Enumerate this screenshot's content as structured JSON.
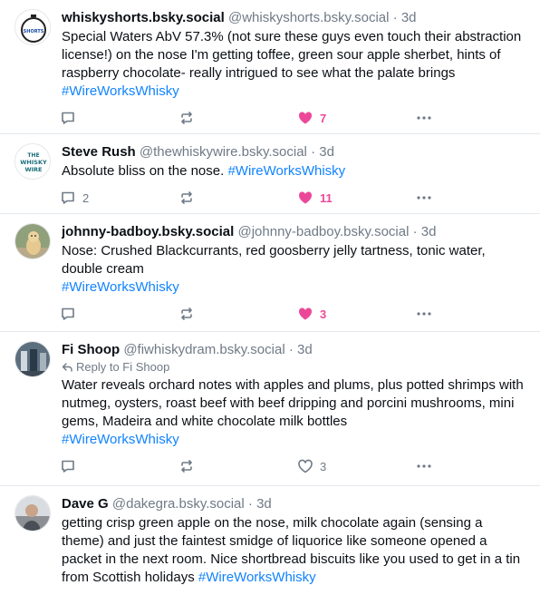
{
  "posts": [
    {
      "name": "whiskyshorts.bsky.social",
      "handle": "@whiskyshorts.bsky.social",
      "time": "3d",
      "text": "Special Waters AbV 57.3% (not sure these guys even touch their abstraction license!) on the nose I'm getting toffee, green sour apple sherbet, hints of raspberry chocolate- really intrigued to see what the palate brings ",
      "hashtag": "#WireWorksWhisky",
      "replies": "",
      "likes": "7",
      "liked": true
    },
    {
      "name": "Steve Rush",
      "handle": "@thewhiskywire.bsky.social",
      "time": "3d",
      "text": "Absolute bliss on the nose. ",
      "hashtag": "#WireWorksWhisky",
      "replies": "2",
      "likes": "11",
      "liked": true
    },
    {
      "name": "johnny-badboy.bsky.social",
      "handle": "@johnny-badboy.bsky.social",
      "time": "3d",
      "text": "Nose: Crushed Blackcurrants, red goosberry jelly tartness, tonic water, double cream",
      "hashtag": "#WireWorksWhisky",
      "replies": "",
      "likes": "3",
      "liked": true
    },
    {
      "name": "Fi Shoop",
      "handle": "@fiwhiskydram.bsky.social",
      "time": "3d",
      "reply_to": "Reply to Fi Shoop",
      "text": "Water reveals orchard notes with apples and plums, plus potted shrimps with nutmeg, oysters, roast beef with beef dripping and porcini mushrooms, mini gems, Madeira and white chocolate milk bottles",
      "hashtag": "#WireWorksWhisky",
      "replies": "",
      "likes": "3",
      "liked": false
    },
    {
      "name": "Dave G",
      "handle": "@dakegra.bsky.social",
      "time": "3d",
      "text": "getting crisp green apple on the nose, milk chocolate again (sensing a theme) and just the faintest smidge of liquorice like someone opened a packet in the next room. Nice shortbread biscuits like you used to get in a tin from Scottish holidays ",
      "hashtag": "#WireWorksWhisky"
    }
  ],
  "avatars": {
    "whiskyshorts_text": "SHORTS",
    "thewhiskywire_text": [
      "THE",
      "WHISKY",
      "WIRE"
    ]
  },
  "colors": {
    "accent": "#1083fe",
    "like": "#ec4899",
    "muted": "#6f7a86"
  }
}
